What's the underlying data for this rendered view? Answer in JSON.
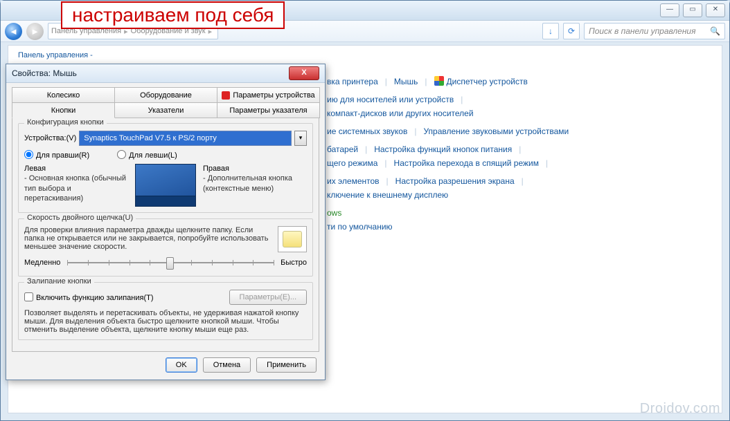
{
  "annotation": "настраиваем под себя",
  "watermark": "Droidov.com",
  "window": {
    "breadcrumb": {
      "a": "Панель управления",
      "b": "Оборудование и звук"
    },
    "search_placeholder": "Поиск в панели управления",
    "subheader": "Панель управления -"
  },
  "cp": {
    "r1": {
      "a": "вка принтера",
      "b": "Мышь",
      "c": "Диспетчер устройств"
    },
    "r2": {
      "a": "ию для носителей или устройств",
      "b": "компакт-дисков или других носителей"
    },
    "r3": {
      "a": "ие системных звуков",
      "b": "Управление звуковыми устройствами"
    },
    "r4": {
      "a": "батарей",
      "b": "Настройка функций кнопок питания",
      "c": "щего режима",
      "d": "Настройка перехода в спящий режим"
    },
    "r5": {
      "a": "их элементов",
      "b": "Настройка разрешения экрана",
      "c": "ключение к внешнему дисплею"
    },
    "r6": {
      "a": "ows",
      "b": "ти по умолчанию"
    }
  },
  "dlg": {
    "title": "Свойства: Мышь",
    "tabs": {
      "wheel": "Колесико",
      "hw": "Оборудование",
      "devparams": "Параметры устройства",
      "buttons": "Кнопки",
      "pointers": "Указатели",
      "ptropts": "Параметры указателя"
    },
    "g1": {
      "legend": "Конфигурация кнопки",
      "device_label": "Устройства:(V)",
      "device_value": "Synaptics TouchPad V7.5 к PS/2 порту",
      "right": "Для правши(R)",
      "left": "Для левши(L)",
      "colL_title": "Левая",
      "colL_text": "- Основная кнопка (обычный тип выбора и перетаскивания)",
      "colR_title": "Правая",
      "colR_text": "- Дополнительная кнопка (контекстные меню)"
    },
    "g2": {
      "legend": "Скорость двойного щелчка(U)",
      "text": "Для проверки влияния параметра дважды щелкните папку. Если папка не открывается или не закрывается, попробуйте использовать меньшее значение скорости.",
      "slow": "Медленно",
      "fast": "Быстро"
    },
    "g3": {
      "legend": "Залипание кнопки",
      "chk": "Включить функцию залипания(T)",
      "params": "Параметры(E)...",
      "text": "Позволяет выделять и перетаскивать объекты, не удерживая нажатой кнопку мыши. Для выделения объекта быстро щелкните кнопкой мыши. Чтобы отменить выделение объекта, щелкните кнопку мыши еще раз."
    },
    "buttons": {
      "ok": "OK",
      "cancel": "Отмена",
      "apply": "Применить"
    }
  }
}
